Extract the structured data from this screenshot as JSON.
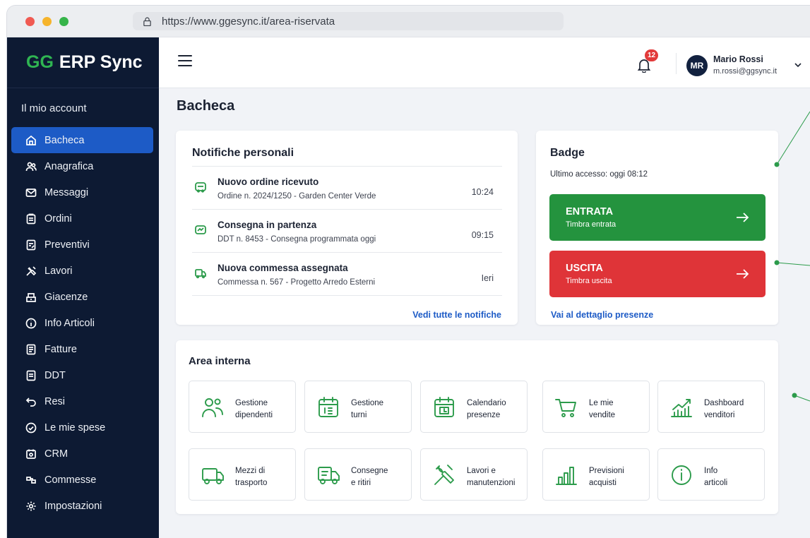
{
  "browser": {
    "url": "https://www.ggesync.it/area-riservata"
  },
  "app": {
    "logo_prefix": "GG",
    "logo_rest": "ERP Sync"
  },
  "sidebar": {
    "section_label": "Il mio account",
    "items": [
      {
        "label": "Bacheca",
        "icon": "dashboard-icon",
        "active": true
      },
      {
        "label": "Anagrafica",
        "icon": "users-icon"
      },
      {
        "label": "Messaggi",
        "icon": "mail-icon"
      },
      {
        "label": "Ordini",
        "icon": "clipboard-icon"
      },
      {
        "label": "Preventivi",
        "icon": "document-edit-icon"
      },
      {
        "label": "Lavori",
        "icon": "tools-icon"
      },
      {
        "label": "Giacenze",
        "icon": "boxes-icon"
      },
      {
        "label": "Info Articoli",
        "icon": "info-icon"
      },
      {
        "label": "Fatture",
        "icon": "invoice-icon"
      },
      {
        "label": "DDT",
        "icon": "document-icon"
      },
      {
        "label": "Resi",
        "icon": "return-icon"
      },
      {
        "label": "Le mie spese",
        "icon": "expenses-icon"
      },
      {
        "label": "CRM",
        "icon": "crm-icon"
      },
      {
        "label": "Commesse",
        "icon": "projects-icon"
      },
      {
        "label": "Impostazioni",
        "icon": "gear-icon"
      }
    ]
  },
  "topbar": {
    "notification_count": "12",
    "user": {
      "initials": "MR",
      "name": "Mario Rossi",
      "email": "m.rossi@ggsync.it"
    }
  },
  "page": {
    "title": "Bacheca"
  },
  "notifications": {
    "title": "Notifiche personali",
    "items": [
      {
        "title": "Nuovo ordine ricevuto",
        "subtitle": "Ordine n. 2024/1250 - Garden Center Verde",
        "time": "10:24",
        "icon": "cart-icon"
      },
      {
        "title": "Consegna in partenza",
        "subtitle": "DDT n. 8453 - Consegna programmata oggi",
        "time": "09:15",
        "icon": "delivery-icon"
      },
      {
        "title": "Nuova commessa assegnata",
        "subtitle": "Commessa n. 567 - Progetto Arredo Esterni",
        "time": "Ieri",
        "icon": "truck-icon"
      }
    ],
    "view_all": "Vedi tutte le notifiche"
  },
  "badge": {
    "title": "Badge",
    "last_access": "Ultimo accesso: oggi 08:12",
    "in": {
      "label": "ENTRATA",
      "sub": "Timbra entrata",
      "color": "#24933e"
    },
    "out": {
      "label": "USCITA",
      "sub": "Timbra uscita",
      "color": "#df3438"
    },
    "detail_link": "Vai al dettaglio presenze"
  },
  "area_interna": {
    "title": "Area interna",
    "tiles": [
      {
        "line1": "Gestione",
        "line2": "dipendenti",
        "icon": "employees-icon"
      },
      {
        "line1": "Gestione",
        "line2": "turni",
        "icon": "shifts-calendar-icon"
      },
      {
        "line1": "Calendario",
        "line2": "presenze",
        "icon": "attendance-calendar-icon"
      },
      {
        "line1": "Le mie",
        "line2": "vendite",
        "icon": "shopping-cart-icon"
      },
      {
        "line1": "Dashboard",
        "line2": "venditori",
        "icon": "growth-chart-icon"
      },
      {
        "line1": "Mezzi di",
        "line2": "trasporto",
        "icon": "van-icon"
      },
      {
        "line1": "Consegne",
        "line2": "e ritiri",
        "icon": "delivery-truck-icon"
      },
      {
        "line1": "Lavori e",
        "line2": "manutenzioni",
        "icon": "wrench-icon"
      },
      {
        "line1": "Previsioni",
        "line2": "acquisti",
        "icon": "bar-chart-icon"
      },
      {
        "line1": "Info",
        "line2": "articoli",
        "icon": "info-circle-icon"
      }
    ]
  },
  "colors": {
    "sidebar_bg": "#0d1a33",
    "accent_blue": "#1d5bc6",
    "accent_green": "#2c9b4b",
    "danger": "#df3438"
  }
}
